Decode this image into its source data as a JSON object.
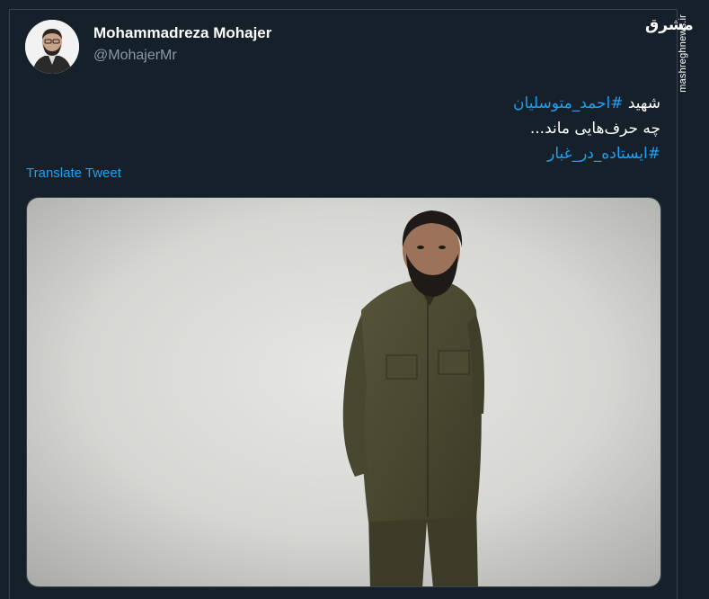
{
  "tweet": {
    "author": {
      "display_name": "Mohammadreza Mohajer",
      "handle": "@MohajerMr"
    },
    "text_lines": [
      {
        "prefix": "شهید ",
        "hashtag": "#احمد_متوسلیان"
      },
      {
        "text": "چه حرف‌هایی ماند..."
      },
      {
        "hashtag": "#ایستاده_در_غبار"
      }
    ],
    "translate_label": "Translate Tweet"
  },
  "watermark": {
    "logo": "مشرق",
    "site": "mashreghnews.ir"
  },
  "colors": {
    "background": "#15202b",
    "link": "#1da1f2",
    "secondary_text": "#8899a6",
    "border": "#38444d"
  }
}
